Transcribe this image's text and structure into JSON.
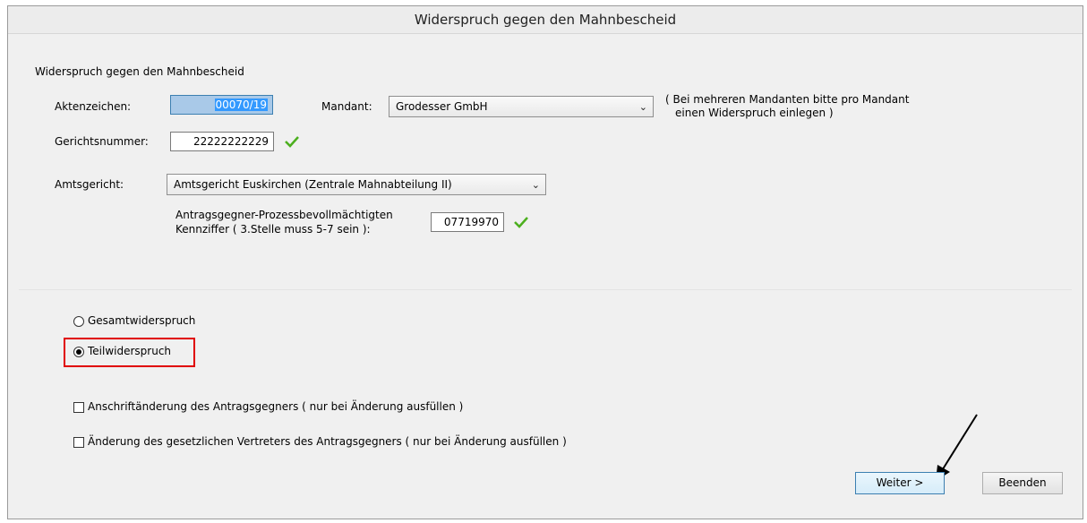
{
  "window": {
    "title": "Widerspruch gegen den Mahnbescheid"
  },
  "form": {
    "group_label": "Widerspruch gegen den Mahnbescheid",
    "aktenzeichen_label": "Aktenzeichen:",
    "aktenzeichen_value": "00070/19",
    "mandant_label": "Mandant:",
    "mandant_value": "Grodesser GmbH",
    "mandant_note_line1": "( Bei mehreren Mandanten bitte pro Mandant",
    "mandant_note_line2": "einen Widerspruch einlegen )",
    "gerichtsnummer_label": "Gerichtsnummer:",
    "gerichtsnummer_value": "22222222229",
    "amtsgericht_label": "Amtsgericht:",
    "amtsgericht_value": "Amtsgericht Euskirchen (Zentrale Mahnabteilung II)",
    "kennziffer_label_line1": "Antragsgegner-Prozessbevollmächtigten",
    "kennziffer_label_line2": "Kennziffer ( 3.Stelle muss 5-7 sein ):",
    "kennziffer_value": "07719970"
  },
  "options": {
    "gesamt_label": "Gesamtwiderspruch",
    "teil_label": "Teilwiderspruch",
    "selected": "Teilwiderspruch",
    "anschrift_label": "Anschriftänderung des Antragsgegners  ( nur bei Änderung ausfüllen )",
    "vertreter_label": "Änderung des gesetzlichen Vertreters des Antragsgegners  ( nur bei Änderung ausfüllen )"
  },
  "buttons": {
    "weiter": "Weiter >",
    "beenden": "Beenden"
  },
  "icons": {
    "valid": "checkmark-icon",
    "dropdown": "chevron-down-icon"
  },
  "colors": {
    "highlight": "#e00000",
    "valid_check": "#4caf1e",
    "selection": "#3399ff"
  }
}
